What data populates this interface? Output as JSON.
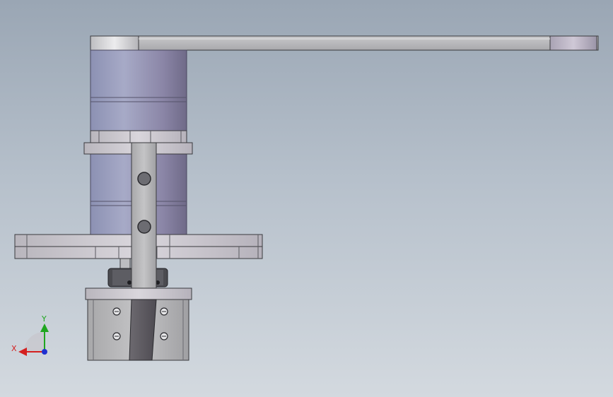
{
  "viewport": {
    "background_top": "#9aa6b4",
    "background_bottom": "#d3d9df"
  },
  "triad": {
    "x_label": "X",
    "y_label": "Y",
    "x_color": "#d42020",
    "y_color": "#1fa61f",
    "z_color": "#2030d0"
  }
}
